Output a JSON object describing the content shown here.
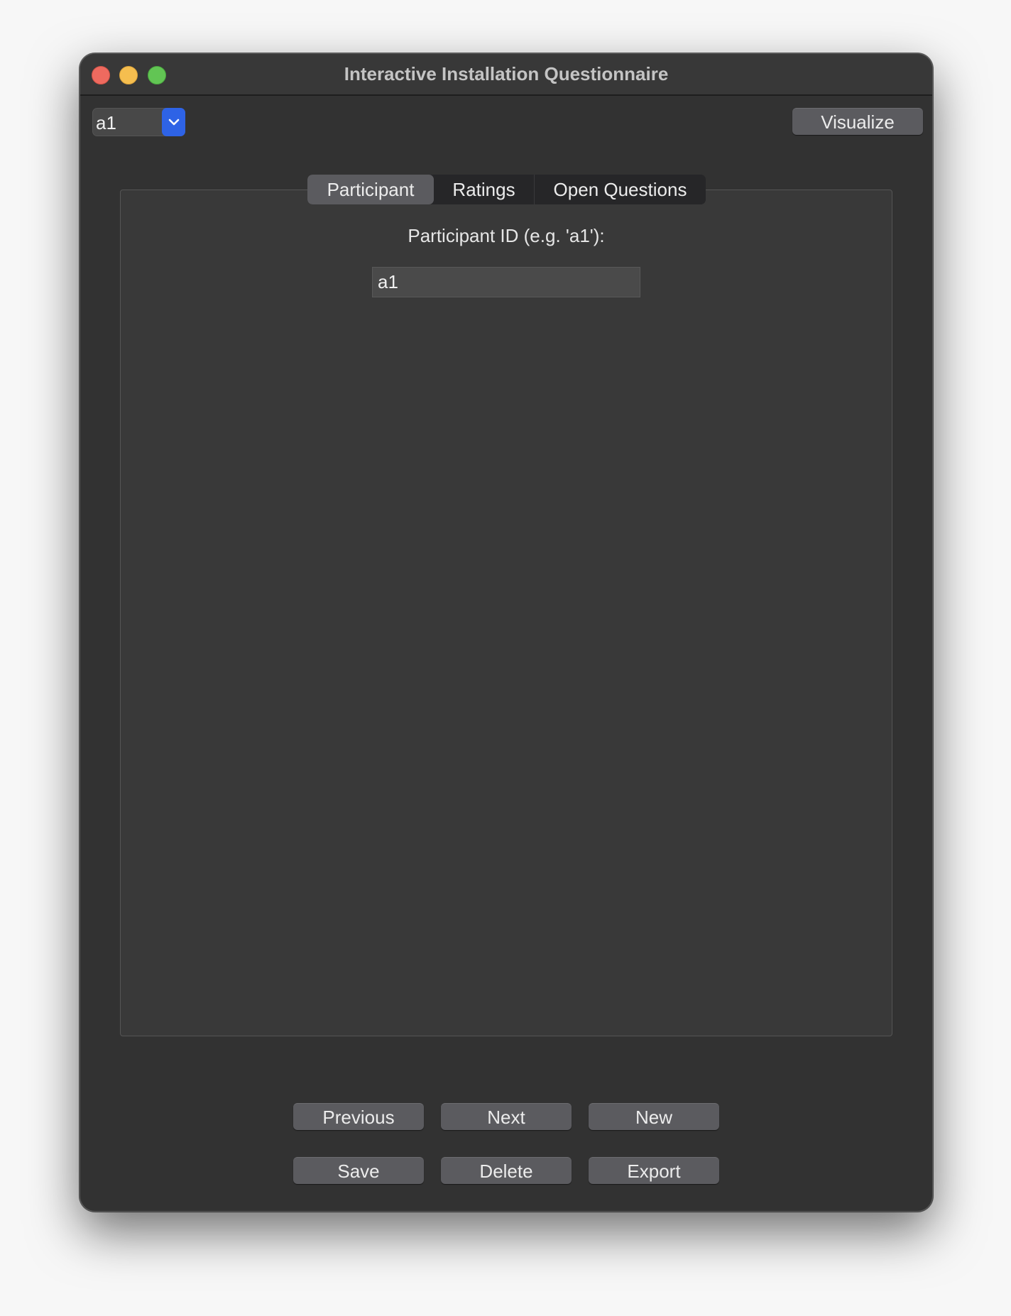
{
  "window": {
    "title": "Interactive Installation Questionnaire"
  },
  "toolbar": {
    "participant_select_value": "a1",
    "visualize_label": "Visualize"
  },
  "tabs": [
    {
      "label": "Participant",
      "active": true
    },
    {
      "label": "Ratings",
      "active": false
    },
    {
      "label": "Open Questions",
      "active": false
    }
  ],
  "participant_tab": {
    "id_label": "Participant ID (e.g. 'a1'):",
    "id_value": "a1"
  },
  "buttons": {
    "previous": "Previous",
    "next": "Next",
    "new": "New",
    "save": "Save",
    "delete": "Delete",
    "export": "Export"
  },
  "colors": {
    "window_bg": "#323232",
    "panel_bg": "#393939",
    "button_bg": "#5b5b5f",
    "accent": "#2e63e6"
  }
}
